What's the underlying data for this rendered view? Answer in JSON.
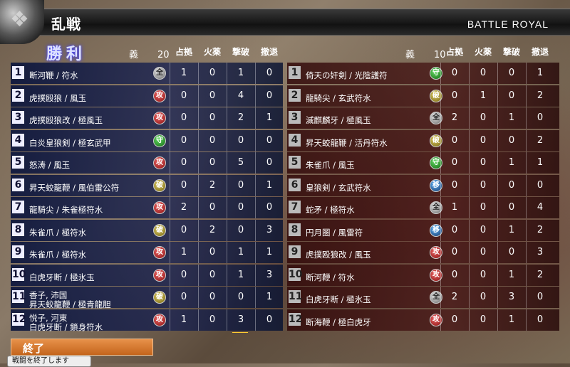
{
  "header": {
    "title": "乱戦",
    "title_en": "BATTLE ROYAL"
  },
  "left": {
    "heading": "勝利",
    "group_label": "義",
    "group_value": "20",
    "columns": [
      "占拠",
      "火薬",
      "撃破",
      "撤退"
    ],
    "rows": [
      {
        "num": "1",
        "names": [
          "断河鞭 / 符水"
        ],
        "badge": "全",
        "c": [
          "1",
          "0",
          "1",
          "0"
        ]
      },
      {
        "num": "2",
        "names": [
          "虎撲殴狼 / 風玉"
        ],
        "badge": "攻",
        "c": [
          "0",
          "0",
          "4",
          "0"
        ]
      },
      {
        "num": "3",
        "names": [
          "虎撲殴狼改 / 極風玉"
        ],
        "badge": "攻",
        "c": [
          "0",
          "0",
          "2",
          "1"
        ]
      },
      {
        "num": "4",
        "names": [
          "白炎皇狼剣 / 極玄武甲"
        ],
        "badge": "守",
        "c": [
          "0",
          "0",
          "0",
          "0"
        ]
      },
      {
        "num": "5",
        "names": [
          "怒涛 / 風玉"
        ],
        "badge": "攻",
        "c": [
          "0",
          "0",
          "5",
          "0"
        ]
      },
      {
        "num": "6",
        "names": [
          "昇天蛟龍鞭 / 風伯雷公符"
        ],
        "badge": "破",
        "c": [
          "0",
          "2",
          "0",
          "1"
        ]
      },
      {
        "num": "7",
        "names": [
          "龍騎尖 / 朱雀極符水"
        ],
        "badge": "攻",
        "c": [
          "2",
          "0",
          "0",
          "0"
        ]
      },
      {
        "num": "8",
        "names": [
          "朱雀爪 / 極符水"
        ],
        "badge": "破",
        "c": [
          "0",
          "2",
          "0",
          "3"
        ]
      },
      {
        "num": "9",
        "names": [
          "朱雀爪 / 極符水"
        ],
        "badge": "攻",
        "c": [
          "1",
          "0",
          "1",
          "1"
        ]
      },
      {
        "num": "10",
        "names": [
          "白虎牙断 / 極氷玉"
        ],
        "badge": "攻",
        "c": [
          "0",
          "0",
          "1",
          "3"
        ]
      },
      {
        "num": "11",
        "names": [
          "香子, 沛国",
          "昇天蛟龍鞭 / 極青龍胆"
        ],
        "badge": "破",
        "c": [
          "0",
          "0",
          "0",
          "1"
        ]
      },
      {
        "num": "12",
        "names": [
          "悦子, 河東",
          "白虎牙断 / 鎖身符水"
        ],
        "badge": "攻",
        "c": [
          "1",
          "0",
          "3",
          "0"
        ]
      }
    ]
  },
  "right": {
    "group_label": "義",
    "group_value": "10",
    "columns": [
      "占拠",
      "火薬",
      "撃破",
      "撤退"
    ],
    "rows": [
      {
        "num": "1",
        "names": [
          "倚天の奸剣 / 光陰護符"
        ],
        "badge": "守",
        "c": [
          "0",
          "0",
          "0",
          "1"
        ]
      },
      {
        "num": "2",
        "names": [
          "龍騎尖 / 玄武符水"
        ],
        "badge": "破",
        "c": [
          "0",
          "1",
          "0",
          "2"
        ]
      },
      {
        "num": "3",
        "names": [
          "滅麒麟牙 / 極風玉"
        ],
        "badge": "全",
        "c": [
          "2",
          "0",
          "1",
          "0"
        ]
      },
      {
        "num": "4",
        "names": [
          "昇天蛟龍鞭 / 活丹符水"
        ],
        "badge": "破",
        "c": [
          "0",
          "0",
          "0",
          "2"
        ]
      },
      {
        "num": "5",
        "names": [
          "朱雀爪 / 風玉"
        ],
        "badge": "守",
        "c": [
          "0",
          "0",
          "1",
          "1"
        ]
      },
      {
        "num": "6",
        "names": [
          "皇狼剣 / 玄武符水"
        ],
        "badge": "移",
        "c": [
          "0",
          "0",
          "0",
          "0"
        ]
      },
      {
        "num": "7",
        "names": [
          "蛇矛 / 極符水"
        ],
        "badge": "全",
        "c": [
          "1",
          "0",
          "0",
          "4"
        ]
      },
      {
        "num": "8",
        "names": [
          "円月圏 / 風雷符"
        ],
        "badge": "移",
        "c": [
          "0",
          "0",
          "1",
          "2"
        ]
      },
      {
        "num": "9",
        "names": [
          "虎撲殴狼改 / 風玉"
        ],
        "badge": "攻",
        "c": [
          "0",
          "0",
          "0",
          "3"
        ]
      },
      {
        "num": "10",
        "names": [
          "断河鞭 / 符水"
        ],
        "badge": "攻",
        "c": [
          "0",
          "0",
          "1",
          "2"
        ]
      },
      {
        "num": "11",
        "names": [
          "白虎牙断 / 極氷玉"
        ],
        "badge": "全",
        "c": [
          "2",
          "0",
          "3",
          "0"
        ]
      },
      {
        "num": "12",
        "names": [
          "断海鞭 / 極白虎牙"
        ],
        "badge": "攻",
        "c": [
          "0",
          "0",
          "1",
          "0"
        ]
      }
    ]
  },
  "footer": {
    "button_label": "終了",
    "tooltip": "戦闘を終了します"
  }
}
